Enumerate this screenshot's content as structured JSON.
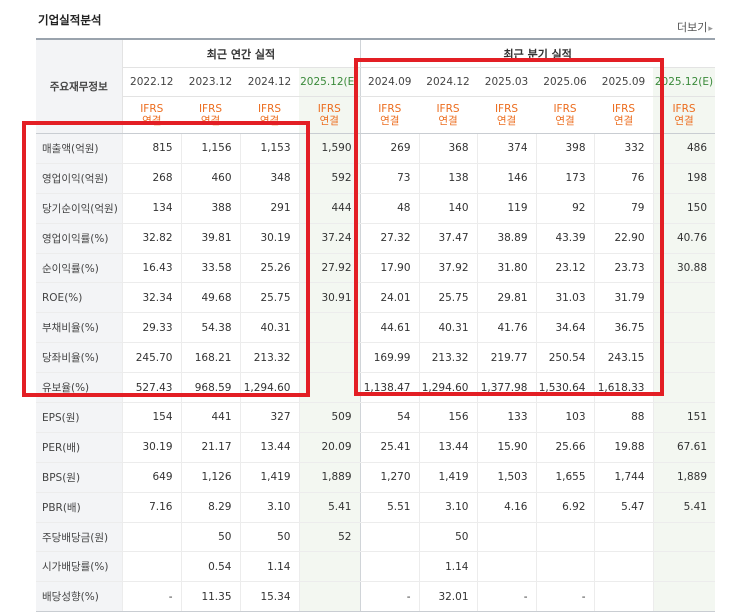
{
  "title": "기업실적분석",
  "more_label": "더보기",
  "group_headers": {
    "main": "주요재무정보",
    "annual": "최근 연간 실적",
    "quarterly": "최근 분기 실적"
  },
  "periods": [
    {
      "label": "2022.12",
      "est": false,
      "type": "IFRS\n연결"
    },
    {
      "label": "2023.12",
      "est": false,
      "type": "IFRS\n연결"
    },
    {
      "label": "2024.12",
      "est": false,
      "type": "IFRS\n연결"
    },
    {
      "label": "2025.12(E)",
      "est": true,
      "type": "IFRS\n연결"
    },
    {
      "label": "2024.09",
      "est": false,
      "type": "IFRS\n연결"
    },
    {
      "label": "2024.12",
      "est": false,
      "type": "IFRS\n연결"
    },
    {
      "label": "2025.03",
      "est": false,
      "type": "IFRS\n연결"
    },
    {
      "label": "2025.06",
      "est": false,
      "type": "IFRS\n연결"
    },
    {
      "label": "2025.09",
      "est": false,
      "type": "IFRS\n연결"
    },
    {
      "label": "2025.12(E)",
      "est": true,
      "type": "IFRS\n연결"
    }
  ],
  "rows": [
    {
      "label": "매출액(억원)",
      "values": [
        "815",
        "1,156",
        "1,153",
        "1,590",
        "269",
        "368",
        "374",
        "398",
        "332",
        "486"
      ]
    },
    {
      "label": "영업이익(억원)",
      "values": [
        "268",
        "460",
        "348",
        "592",
        "73",
        "138",
        "146",
        "173",
        "76",
        "198"
      ]
    },
    {
      "label": "당기순이익(억원)",
      "values": [
        "134",
        "388",
        "291",
        "444",
        "48",
        "140",
        "119",
        "92",
        "79",
        "150"
      ]
    },
    {
      "label": "영업이익률(%)",
      "values": [
        "32.82",
        "39.81",
        "30.19",
        "37.24",
        "27.32",
        "37.47",
        "38.89",
        "43.39",
        "22.90",
        "40.76"
      ]
    },
    {
      "label": "순이익률(%)",
      "values": [
        "16.43",
        "33.58",
        "25.26",
        "27.92",
        "17.90",
        "37.92",
        "31.80",
        "23.12",
        "23.73",
        "30.88"
      ]
    },
    {
      "label": "ROE(%)",
      "values": [
        "32.34",
        "49.68",
        "25.75",
        "30.91",
        "24.01",
        "25.75",
        "29.81",
        "31.03",
        "31.79",
        ""
      ]
    },
    {
      "label": "부채비율(%)",
      "values": [
        "29.33",
        "54.38",
        "40.31",
        "",
        "44.61",
        "40.31",
        "41.76",
        "34.64",
        "36.75",
        ""
      ]
    },
    {
      "label": "당좌비율(%)",
      "values": [
        "245.70",
        "168.21",
        "213.32",
        "",
        "169.99",
        "213.32",
        "219.77",
        "250.54",
        "243.15",
        ""
      ]
    },
    {
      "label": "유보율(%)",
      "values": [
        "527.43",
        "968.59",
        "1,294.60",
        "",
        "1,138.47",
        "1,294.60",
        "1,377.98",
        "1,530.64",
        "1,618.33",
        ""
      ]
    },
    {
      "label": "EPS(원)",
      "values": [
        "154",
        "441",
        "327",
        "509",
        "54",
        "156",
        "133",
        "103",
        "88",
        "151"
      ]
    },
    {
      "label": "PER(배)",
      "values": [
        "30.19",
        "21.17",
        "13.44",
        "20.09",
        "25.41",
        "13.44",
        "15.90",
        "25.66",
        "19.88",
        "67.61"
      ]
    },
    {
      "label": "BPS(원)",
      "values": [
        "649",
        "1,126",
        "1,419",
        "1,889",
        "1,270",
        "1,419",
        "1,503",
        "1,655",
        "1,744",
        "1,889"
      ]
    },
    {
      "label": "PBR(배)",
      "values": [
        "7.16",
        "8.29",
        "3.10",
        "5.41",
        "5.51",
        "3.10",
        "4.16",
        "6.92",
        "5.47",
        "5.41"
      ]
    },
    {
      "label": "주당배당금(원)",
      "values": [
        "",
        "50",
        "50",
        "52",
        "",
        "50",
        "",
        "",
        "",
        ""
      ]
    },
    {
      "label": "시가배당률(%)",
      "values": [
        "",
        "0.54",
        "1.14",
        "",
        "",
        "1.14",
        "",
        "",
        "",
        ""
      ]
    },
    {
      "label": "배당성향(%)",
      "values": [
        "-",
        "11.35",
        "15.34",
        "",
        "-",
        "32.01",
        "-",
        "-",
        "",
        ""
      ]
    }
  ],
  "highlight_color": "#e31e24"
}
